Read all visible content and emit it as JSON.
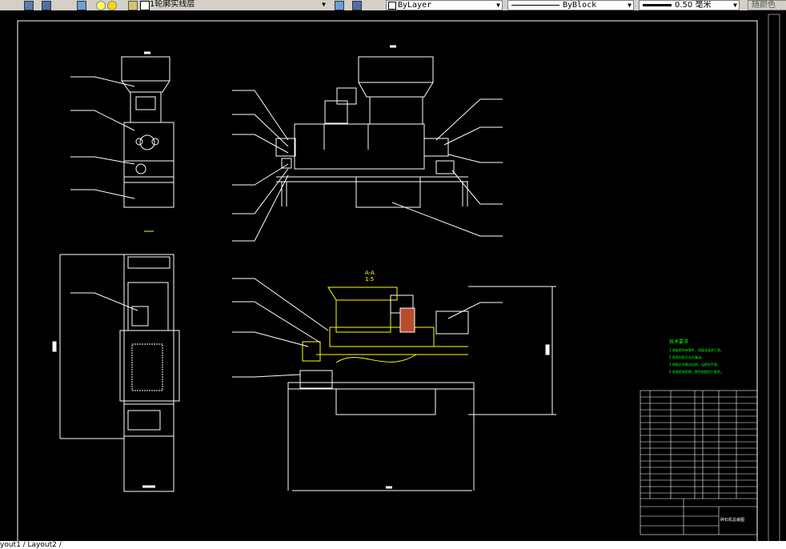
{
  "toolbar": {
    "layer_name": "1轮廓实线层",
    "color_value": "ByLayer",
    "linetype_value": "ByBlock",
    "lineweight_value": "0.50 毫米",
    "plotstyle_value": "随颜色"
  },
  "drawing": {
    "section_label": "A-A",
    "section_scale": "1:5",
    "notes_title": "技术要求",
    "notes": [
      "1.装配前所有零件，用煤油清洗干净。",
      "2.各密封处不允许漏油。",
      "3.装配后空载试运转，运转应平稳。",
      "4.表面喷漆防锈，颜色根据用户要求。"
    ],
    "title_block_name": "碎石机总装图"
  },
  "tabs": {
    "text": "yout1 / Layout2 /"
  },
  "colors": {
    "background": "#000000",
    "lines": "#ffffff",
    "section": "#ffff00",
    "notes": "#00ff00",
    "frame": "#ffffff"
  }
}
